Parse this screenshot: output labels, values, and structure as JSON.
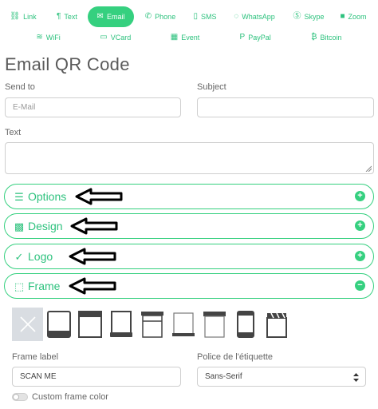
{
  "tabs_row1": [
    {
      "label": "Link",
      "icon": "link-icon",
      "glyph": "⛓"
    },
    {
      "label": "Text",
      "icon": "text-icon",
      "glyph": "¶"
    },
    {
      "label": "Email",
      "icon": "envelope-icon",
      "glyph": "✉",
      "active": true
    },
    {
      "label": "Phone",
      "icon": "phone-icon",
      "glyph": "✆"
    },
    {
      "label": "SMS",
      "icon": "sms-icon",
      "glyph": "▯"
    },
    {
      "label": "WhatsApp",
      "icon": "whatsapp-icon",
      "glyph": "◌"
    },
    {
      "label": "Skype",
      "icon": "skype-icon",
      "glyph": "Ⓢ"
    },
    {
      "label": "Zoom",
      "icon": "zoom-icon",
      "glyph": "■"
    }
  ],
  "tabs_row2": [
    {
      "label": "WiFi",
      "icon": "wifi-icon",
      "glyph": "≋"
    },
    {
      "label": "VCard",
      "icon": "vcard-icon",
      "glyph": "▭"
    },
    {
      "label": "Event",
      "icon": "calendar-icon",
      "glyph": "▦"
    },
    {
      "label": "PayPal",
      "icon": "paypal-icon",
      "glyph": "P"
    },
    {
      "label": "Bitcoin",
      "icon": "bitcoin-icon",
      "glyph": "₿"
    }
  ],
  "page_title": "Email QR Code",
  "form": {
    "send_to_label": "Send to",
    "send_to_placeholder": "E-Mail",
    "subject_label": "Subject",
    "subject_placeholder": "",
    "text_label": "Text"
  },
  "sections": [
    {
      "label": "Options",
      "icon": "options-icon",
      "glyph": "☰",
      "expanded": false
    },
    {
      "label": "Design",
      "icon": "design-icon",
      "glyph": "▩",
      "expanded": false
    },
    {
      "label": "Logo",
      "icon": "logo-icon",
      "glyph": "✓",
      "expanded": false
    },
    {
      "label": "Frame",
      "icon": "frame-icon",
      "glyph": "⬚",
      "expanded": true
    }
  ],
  "frame_options": [
    "none",
    "frame-1",
    "frame-2",
    "frame-3",
    "frame-4",
    "frame-5",
    "frame-6",
    "frame-7",
    "frame-8"
  ],
  "frame_label": {
    "label": "Frame label",
    "value": "SCAN ME"
  },
  "font_select": {
    "label": "Police de l'étiquette",
    "value": "Sans-Serif"
  },
  "custom_frame_color": "Custom frame color",
  "colors": {
    "accent": "#35d07f",
    "accent_text": "#2ec27e"
  }
}
